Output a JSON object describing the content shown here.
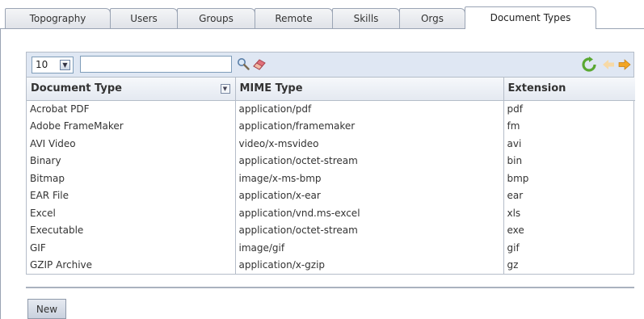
{
  "tabs": [
    {
      "label": "Topography"
    },
    {
      "label": "Users"
    },
    {
      "label": "Groups"
    },
    {
      "label": "Remote"
    },
    {
      "label": "Skills"
    },
    {
      "label": "Orgs"
    },
    {
      "label": "Document Types",
      "active": true
    }
  ],
  "toolbar": {
    "page_size": "10",
    "search_value": "",
    "search_placeholder": "",
    "icons": [
      "search-icon",
      "eraser-icon",
      "refresh-icon",
      "previous-page-icon",
      "next-page-icon"
    ]
  },
  "table": {
    "columns": [
      "Document Type",
      "MIME Type",
      "Extension"
    ],
    "rows": [
      [
        "Acrobat PDF",
        "application/pdf",
        "pdf"
      ],
      [
        "Adobe FrameMaker",
        "application/framemaker",
        "fm"
      ],
      [
        "AVI Video",
        "video/x-msvideo",
        "avi"
      ],
      [
        "Binary",
        "application/octet-stream",
        "bin"
      ],
      [
        "Bitmap",
        "image/x-ms-bmp",
        "bmp"
      ],
      [
        "EAR File",
        "application/x-ear",
        "ear"
      ],
      [
        "Excel",
        "application/vnd.ms-excel",
        "xls"
      ],
      [
        "Executable",
        "application/octet-stream",
        "exe"
      ],
      [
        "GIF",
        "image/gif",
        "gif"
      ],
      [
        "GZIP Archive",
        "application/x-gzip",
        "gz"
      ]
    ]
  },
  "actions": {
    "new_label": "New"
  },
  "colors": {
    "toolbar_bg": "#dfe7f3",
    "border": "#b5bdc9",
    "refresh_green": "#5aa832",
    "arrow_orange": "#f2a524"
  }
}
